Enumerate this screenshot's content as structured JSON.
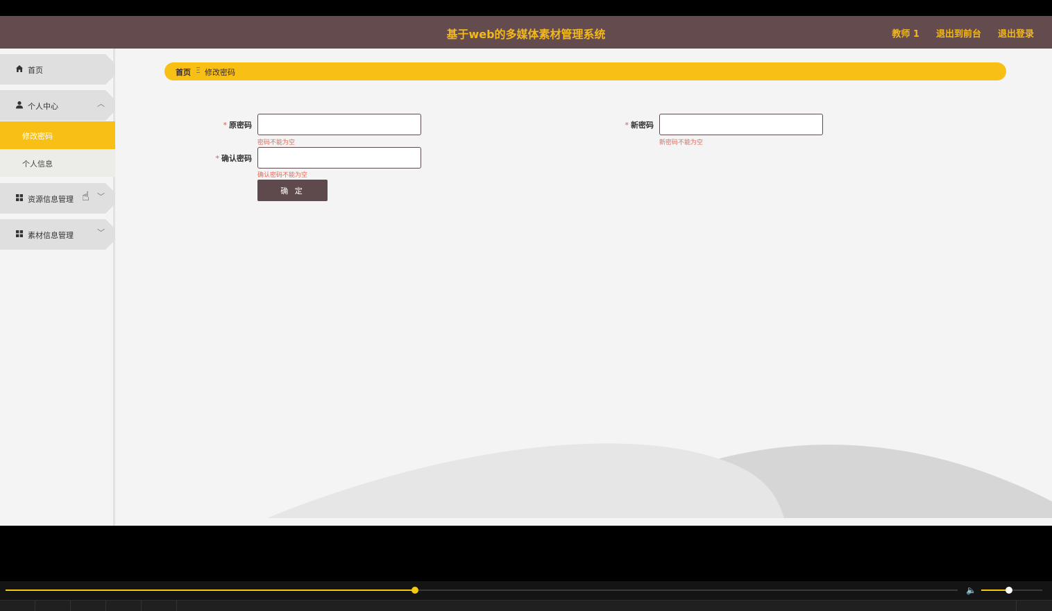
{
  "header": {
    "title": "基于web的多媒体素材管理系统",
    "links": [
      "教师 1",
      "退出到前台",
      "退出登录"
    ]
  },
  "sidebar": {
    "items": [
      {
        "label": "首页",
        "icon": "home-icon"
      },
      {
        "label": "个人中心",
        "icon": "user-icon",
        "expanded": true,
        "children": [
          {
            "label": "修改密码",
            "active": true
          },
          {
            "label": "个人信息",
            "active": false
          }
        ]
      },
      {
        "label": "资源信息管理",
        "icon": "grid-icon",
        "expanded": false
      },
      {
        "label": "素材信息管理",
        "icon": "grid-icon",
        "expanded": false
      }
    ]
  },
  "breadcrumb": {
    "home": "首页",
    "separator": "Ξ",
    "current": "修改密码"
  },
  "form": {
    "old_password": {
      "label": "原密码",
      "value": "",
      "error": "密码不能为空"
    },
    "new_password": {
      "label": "新密码",
      "value": "",
      "error": "新密码不能为空"
    },
    "confirm_password": {
      "label": "确认密码",
      "value": "",
      "error": "确认密码不能为空"
    },
    "submit_label": "确 定",
    "required_mark": "*"
  },
  "player": {
    "progress": 0.43,
    "volume": 0.45
  },
  "colors": {
    "header_bg": "#634b4e",
    "accent": "#f8c014",
    "button_bg": "#5e4a4c",
    "error": "#e06a5a"
  }
}
